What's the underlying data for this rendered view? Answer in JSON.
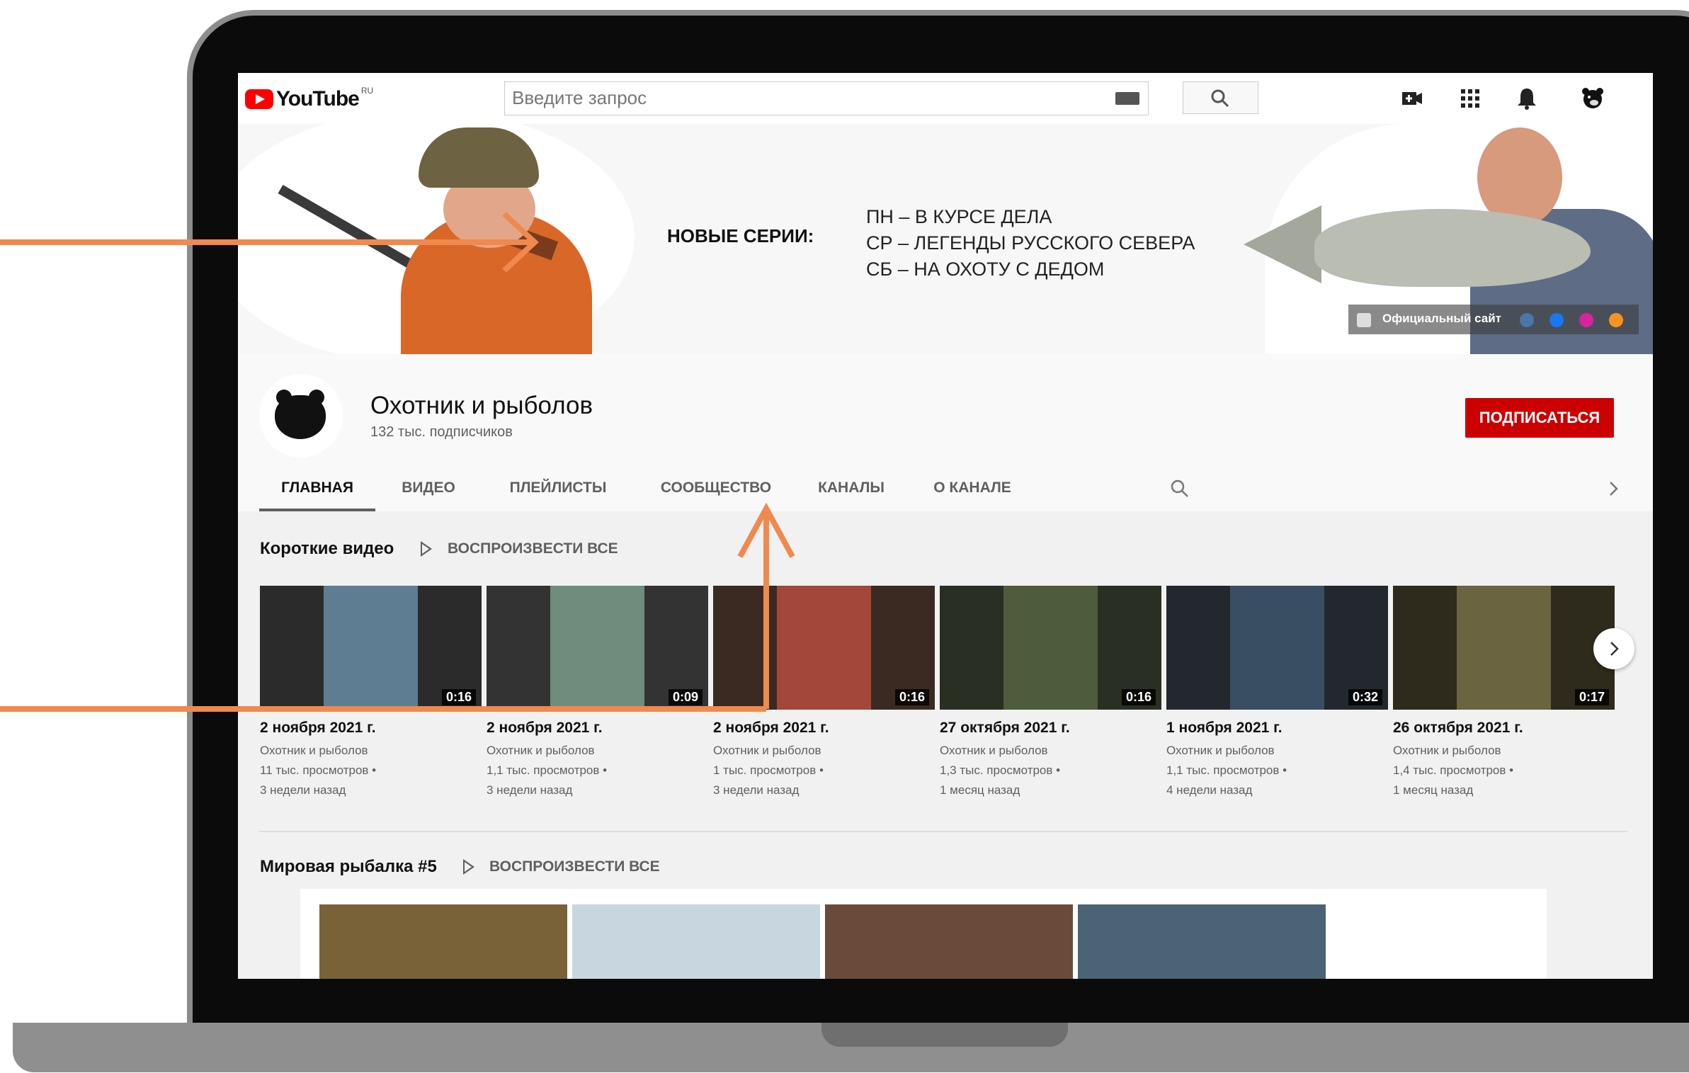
{
  "topbar": {
    "logo_text": "YouTube",
    "logo_region": "RU",
    "search_placeholder": "Введите запрос"
  },
  "banner": {
    "title": "НОВЫЕ СЕРИИ:",
    "schedule": [
      "ПН – В КУРСЕ ДЕЛА",
      "СР – ЛЕГЕНДЫ РУССКОГО СЕВЕРА",
      "СБ – НА ОХОТУ С ДЕДОМ"
    ],
    "official_site": "Официальный сайт"
  },
  "channel": {
    "name": "Охотник и рыболов",
    "subscribers": "132 тыс. подписчиков",
    "subscribe_label": "ПОДПИСАТЬСЯ"
  },
  "tabs": [
    "ГЛАВНАЯ",
    "ВИДЕО",
    "ПЛЕЙЛИСТЫ",
    "СООБЩЕСТВО",
    "КАНАЛЫ",
    "О КАНАЛЕ"
  ],
  "shorts": {
    "title": "Короткие видео",
    "play_all": "ВОСПРОИЗВЕСТИ ВСЕ",
    "items": [
      {
        "date": "2 ноября 2021 г.",
        "channel": "Охотник и рыболов",
        "views": "11 тыс. просмотров •",
        "ago": "3 недели назад",
        "duration": "0:16",
        "color": "#5e7d92"
      },
      {
        "date": "2 ноября 2021 г.",
        "channel": "Охотник и рыболов",
        "views": "1,1 тыс. просмотров •",
        "ago": "3 недели назад",
        "duration": "0:09",
        "color": "#6f8c7d"
      },
      {
        "date": "2 ноября 2021 г.",
        "channel": "Охотник и рыболов",
        "views": "1 тыс. просмотров •",
        "ago": "3 недели назад",
        "duration": "0:16",
        "color": "#a3473a"
      },
      {
        "date": "27 октября 2021 г.",
        "channel": "Охотник и рыболов",
        "views": "1,3 тыс. просмотров •",
        "ago": "1 месяц назад",
        "duration": "0:16",
        "color": "#4e5b3c"
      },
      {
        "date": "1 ноября 2021 г.",
        "channel": "Охотник и рыболов",
        "views": "1,1 тыс. просмотров •",
        "ago": "4 недели назад",
        "duration": "0:32",
        "color": "#3a4e63"
      },
      {
        "date": "26 октября 2021 г.",
        "channel": "Охотник и рыболов",
        "views": "1,4 тыс. просмотров •",
        "ago": "1 месяц назад",
        "duration": "0:17",
        "color": "#6b6440"
      }
    ]
  },
  "playlist": {
    "title": "Мировая рыбалка #5",
    "play_all": "ВОСПРОИЗВЕСТИ ВСЕ"
  },
  "colors": {
    "accent": "#f0894d",
    "subscribe": "#cc0000"
  }
}
